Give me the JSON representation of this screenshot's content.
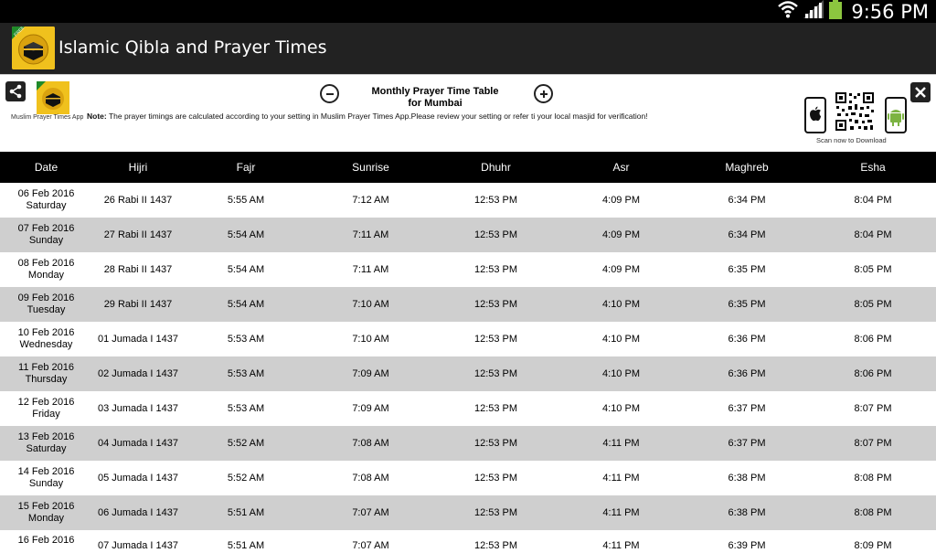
{
  "status": {
    "time": "9:56 PM"
  },
  "app": {
    "title": "Islamic Qibla and Prayer Times",
    "badge": "FREE"
  },
  "banner": {
    "title_line1": "Monthly Prayer Time Table",
    "title_line2": "for Mumbai",
    "note_label": "Note:",
    "note_text": "The prayer timings are calculated according to your setting in Muslim Prayer Times App.Please review your setting or refer ti your local masjid for verification!",
    "app_label": "Muslim Prayer Times App",
    "scan_label": "Scan now to Download"
  },
  "table": {
    "headers": [
      "Date",
      "Hijri",
      "Fajr",
      "Sunrise",
      "Dhuhr",
      "Asr",
      "Maghreb",
      "Esha"
    ],
    "rows": [
      {
        "date": "06 Feb 2016",
        "day": "Saturday",
        "hijri": "26 Rabi II 1437",
        "fajr": "5:55 AM",
        "sunrise": "7:12 AM",
        "dhuhr": "12:53 PM",
        "asr": "4:09 PM",
        "maghreb": "6:34 PM",
        "esha": "8:04 PM"
      },
      {
        "date": "07 Feb 2016",
        "day": "Sunday",
        "hijri": "27 Rabi II 1437",
        "fajr": "5:54 AM",
        "sunrise": "7:11 AM",
        "dhuhr": "12:53 PM",
        "asr": "4:09 PM",
        "maghreb": "6:34 PM",
        "esha": "8:04 PM"
      },
      {
        "date": "08 Feb 2016",
        "day": "Monday",
        "hijri": "28 Rabi II 1437",
        "fajr": "5:54 AM",
        "sunrise": "7:11 AM",
        "dhuhr": "12:53 PM",
        "asr": "4:09 PM",
        "maghreb": "6:35 PM",
        "esha": "8:05 PM"
      },
      {
        "date": "09 Feb 2016",
        "day": "Tuesday",
        "hijri": "29 Rabi II 1437",
        "fajr": "5:54 AM",
        "sunrise": "7:10 AM",
        "dhuhr": "12:53 PM",
        "asr": "4:10 PM",
        "maghreb": "6:35 PM",
        "esha": "8:05 PM"
      },
      {
        "date": "10 Feb 2016",
        "day": "Wednesday",
        "hijri": "01 Jumada I 1437",
        "fajr": "5:53 AM",
        "sunrise": "7:10 AM",
        "dhuhr": "12:53 PM",
        "asr": "4:10 PM",
        "maghreb": "6:36 PM",
        "esha": "8:06 PM"
      },
      {
        "date": "11 Feb 2016",
        "day": "Thursday",
        "hijri": "02 Jumada I 1437",
        "fajr": "5:53 AM",
        "sunrise": "7:09 AM",
        "dhuhr": "12:53 PM",
        "asr": "4:10 PM",
        "maghreb": "6:36 PM",
        "esha": "8:06 PM"
      },
      {
        "date": "12 Feb 2016",
        "day": "Friday",
        "hijri": "03 Jumada I 1437",
        "fajr": "5:53 AM",
        "sunrise": "7:09 AM",
        "dhuhr": "12:53 PM",
        "asr": "4:10 PM",
        "maghreb": "6:37 PM",
        "esha": "8:07 PM"
      },
      {
        "date": "13 Feb 2016",
        "day": "Saturday",
        "hijri": "04 Jumada I 1437",
        "fajr": "5:52 AM",
        "sunrise": "7:08 AM",
        "dhuhr": "12:53 PM",
        "asr": "4:11 PM",
        "maghreb": "6:37 PM",
        "esha": "8:07 PM"
      },
      {
        "date": "14 Feb 2016",
        "day": "Sunday",
        "hijri": "05 Jumada I 1437",
        "fajr": "5:52 AM",
        "sunrise": "7:08 AM",
        "dhuhr": "12:53 PM",
        "asr": "4:11 PM",
        "maghreb": "6:38 PM",
        "esha": "8:08 PM"
      },
      {
        "date": "15 Feb 2016",
        "day": "Monday",
        "hijri": "06 Jumada I 1437",
        "fajr": "5:51 AM",
        "sunrise": "7:07 AM",
        "dhuhr": "12:53 PM",
        "asr": "4:11 PM",
        "maghreb": "6:38 PM",
        "esha": "8:08 PM"
      },
      {
        "date": "16 Feb 2016",
        "day": "",
        "hijri": "07 Jumada I 1437",
        "fajr": "5:51 AM",
        "sunrise": "7:07 AM",
        "dhuhr": "12:53 PM",
        "asr": "4:11 PM",
        "maghreb": "6:39 PM",
        "esha": "8:09 PM"
      }
    ]
  }
}
